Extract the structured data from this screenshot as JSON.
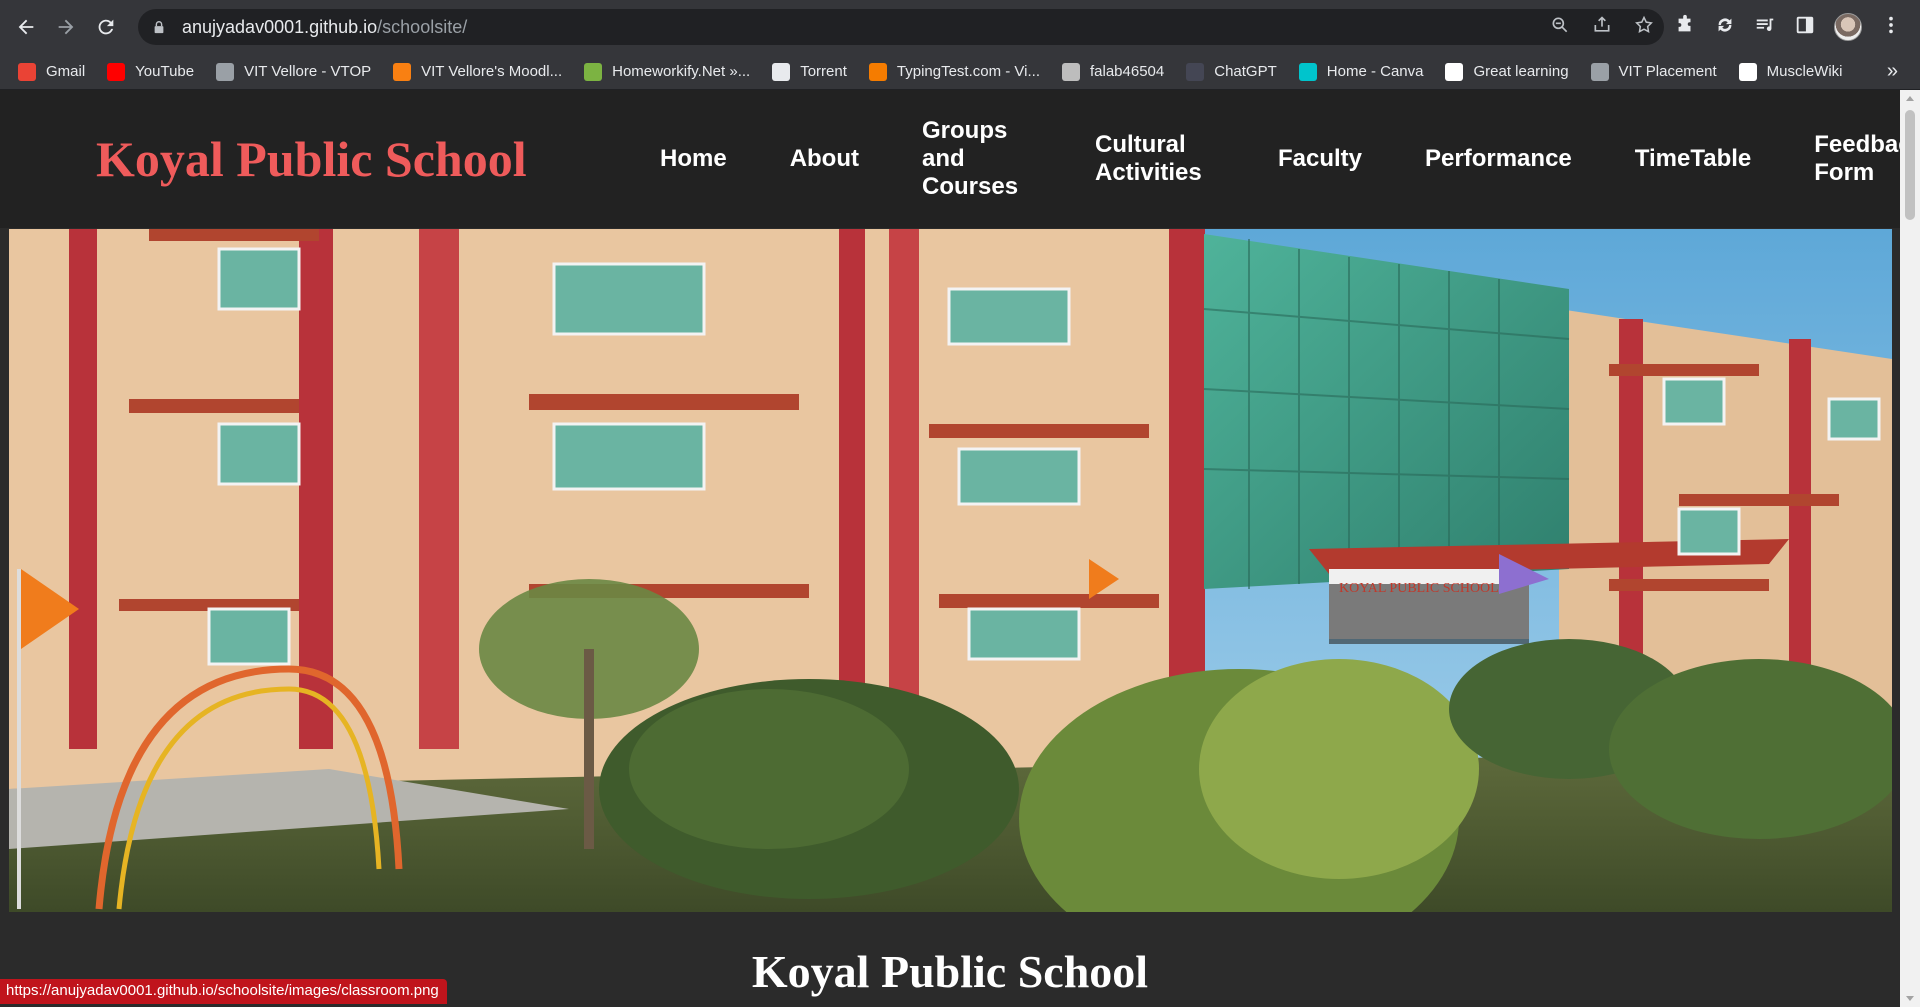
{
  "browser": {
    "url_host": "anujyadav0001.github.io",
    "url_path": "/schoolsite/",
    "bookmarks": [
      {
        "label": "Gmail",
        "icon": "gmail-icon",
        "color": "#ea4335"
      },
      {
        "label": "YouTube",
        "icon": "youtube-icon",
        "color": "#ff0000"
      },
      {
        "label": "VIT Vellore - VTOP",
        "icon": "vtop-icon",
        "color": "#9aa0a6"
      },
      {
        "label": "VIT Vellore's Moodl...",
        "icon": "moodle-icon",
        "color": "#f98012"
      },
      {
        "label": "Homeworkify.Net »...",
        "icon": "homeworkify-icon",
        "color": "#7cb342"
      },
      {
        "label": "Torrent",
        "icon": "torrent-icon",
        "color": "#e8eaed"
      },
      {
        "label": "TypingTest.com - Vi...",
        "icon": "typingtest-icon",
        "color": "#f57c00"
      },
      {
        "label": "falab46504",
        "icon": "falab-icon",
        "color": "#bdbdbd"
      },
      {
        "label": "ChatGPT",
        "icon": "chatgpt-icon",
        "color": "#444654"
      },
      {
        "label": "Home - Canva",
        "icon": "canva-icon",
        "color": "#00c4cc"
      },
      {
        "label": "Great learning",
        "icon": "google-icon",
        "color": "#ffffff"
      },
      {
        "label": "VIT Placement",
        "icon": "placement-icon",
        "color": "#9aa0a6"
      },
      {
        "label": "MuscleWiki",
        "icon": "musclewiki-icon",
        "color": "#ffffff"
      }
    ],
    "status_url": "https://anujyadav0001.github.io/schoolsite/images/classroom.png"
  },
  "site": {
    "logo": "Koyal Public School",
    "logo_color": "#ef5b5b",
    "nav": [
      {
        "label": "Home"
      },
      {
        "label": "About"
      },
      {
        "label": "Groups and Courses"
      },
      {
        "label": "Cultural Activities"
      },
      {
        "label": "Faculty"
      },
      {
        "label": "Performance"
      },
      {
        "label": "TimeTable"
      },
      {
        "label": "Feedback Form"
      }
    ],
    "hero_sign": "KOYAL PUBLIC SCHOOL",
    "title": "Koyal Public School"
  }
}
